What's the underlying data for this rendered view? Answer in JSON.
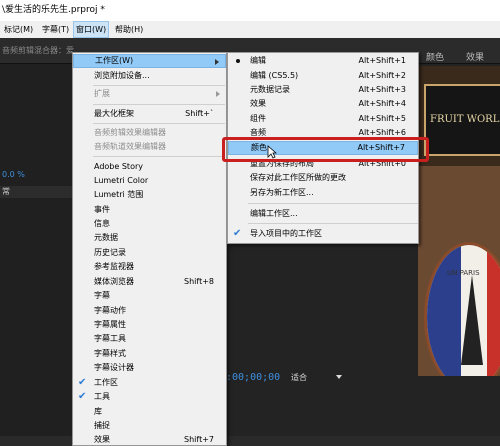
{
  "window": {
    "title": "\\爱生活的乐先生.prproj *"
  },
  "menubar": {
    "items": [
      {
        "label": "标记(M)"
      },
      {
        "label": "字幕(T)"
      },
      {
        "label": "窗口(W)"
      },
      {
        "label": "帮助(H)"
      }
    ]
  },
  "panels": {
    "audio_mixer_tab": "音频剪辑混合器：爱",
    "workspace_tabs": [
      "颜色",
      "效果"
    ],
    "left_value": "0.0 %",
    "left_label": "常"
  },
  "preview": {
    "board_text": "FRUIT WORLD",
    "plate_text": "UN PARIS"
  },
  "timeline": {
    "timecode": ":00;00;00",
    "fit": "适合"
  },
  "window_menu": {
    "items": [
      {
        "label": "工作区(W)",
        "submenu": true
      },
      {
        "label": "浏览附加设备..."
      },
      {
        "label": "扩展",
        "disabled": true,
        "submenu": true
      },
      {
        "label": "最大化框架",
        "shortcut": "Shift+`"
      },
      {
        "label": "音频剪辑效果编辑器",
        "disabled": true
      },
      {
        "label": "音频轨道效果编辑器",
        "disabled": true
      },
      {
        "label": "Adobe Story"
      },
      {
        "label": "Lumetri Color"
      },
      {
        "label": "Lumetri 范围"
      },
      {
        "label": "事件"
      },
      {
        "label": "信息"
      },
      {
        "label": "元数据"
      },
      {
        "label": "历史记录"
      },
      {
        "label": "参考监视器"
      },
      {
        "label": "媒体浏览器",
        "shortcut": "Shift+8"
      },
      {
        "label": "字幕"
      },
      {
        "label": "字幕动作"
      },
      {
        "label": "字幕属性"
      },
      {
        "label": "字幕工具"
      },
      {
        "label": "字幕样式"
      },
      {
        "label": "字幕设计器"
      },
      {
        "label": "工作区",
        "checked": true
      },
      {
        "label": "工具",
        "checked": true
      },
      {
        "label": "库"
      },
      {
        "label": "捕捉"
      },
      {
        "label": "效果",
        "shortcut": "Shift+7"
      }
    ]
  },
  "workspace_submenu": {
    "items": [
      {
        "label": "编辑",
        "shortcut": "Alt+Shift+1",
        "bullet": true
      },
      {
        "label": "编辑 (CS5.5)",
        "shortcut": "Alt+Shift+2"
      },
      {
        "label": "元数据记录",
        "shortcut": "Alt+Shift+3"
      },
      {
        "label": "效果",
        "shortcut": "Alt+Shift+4"
      },
      {
        "label": "组件",
        "shortcut": "Alt+Shift+5"
      },
      {
        "label": "音频",
        "shortcut": "Alt+Shift+6"
      },
      {
        "label": "颜色",
        "shortcut": "Alt+Shift+7",
        "highlighted": true
      },
      {
        "label": "重置为保存的布局",
        "shortcut": "Alt+Shift+0"
      },
      {
        "label": "保存对此工作区所做的更改"
      },
      {
        "label": "另存为新工作区..."
      },
      {
        "label": "编辑工作区..."
      },
      {
        "label": "导入项目中的工作区",
        "checked": true
      }
    ]
  },
  "colors": {
    "highlight": "#91c9f7",
    "annotation": "#c91f1f",
    "check": "#2e7bd6"
  }
}
